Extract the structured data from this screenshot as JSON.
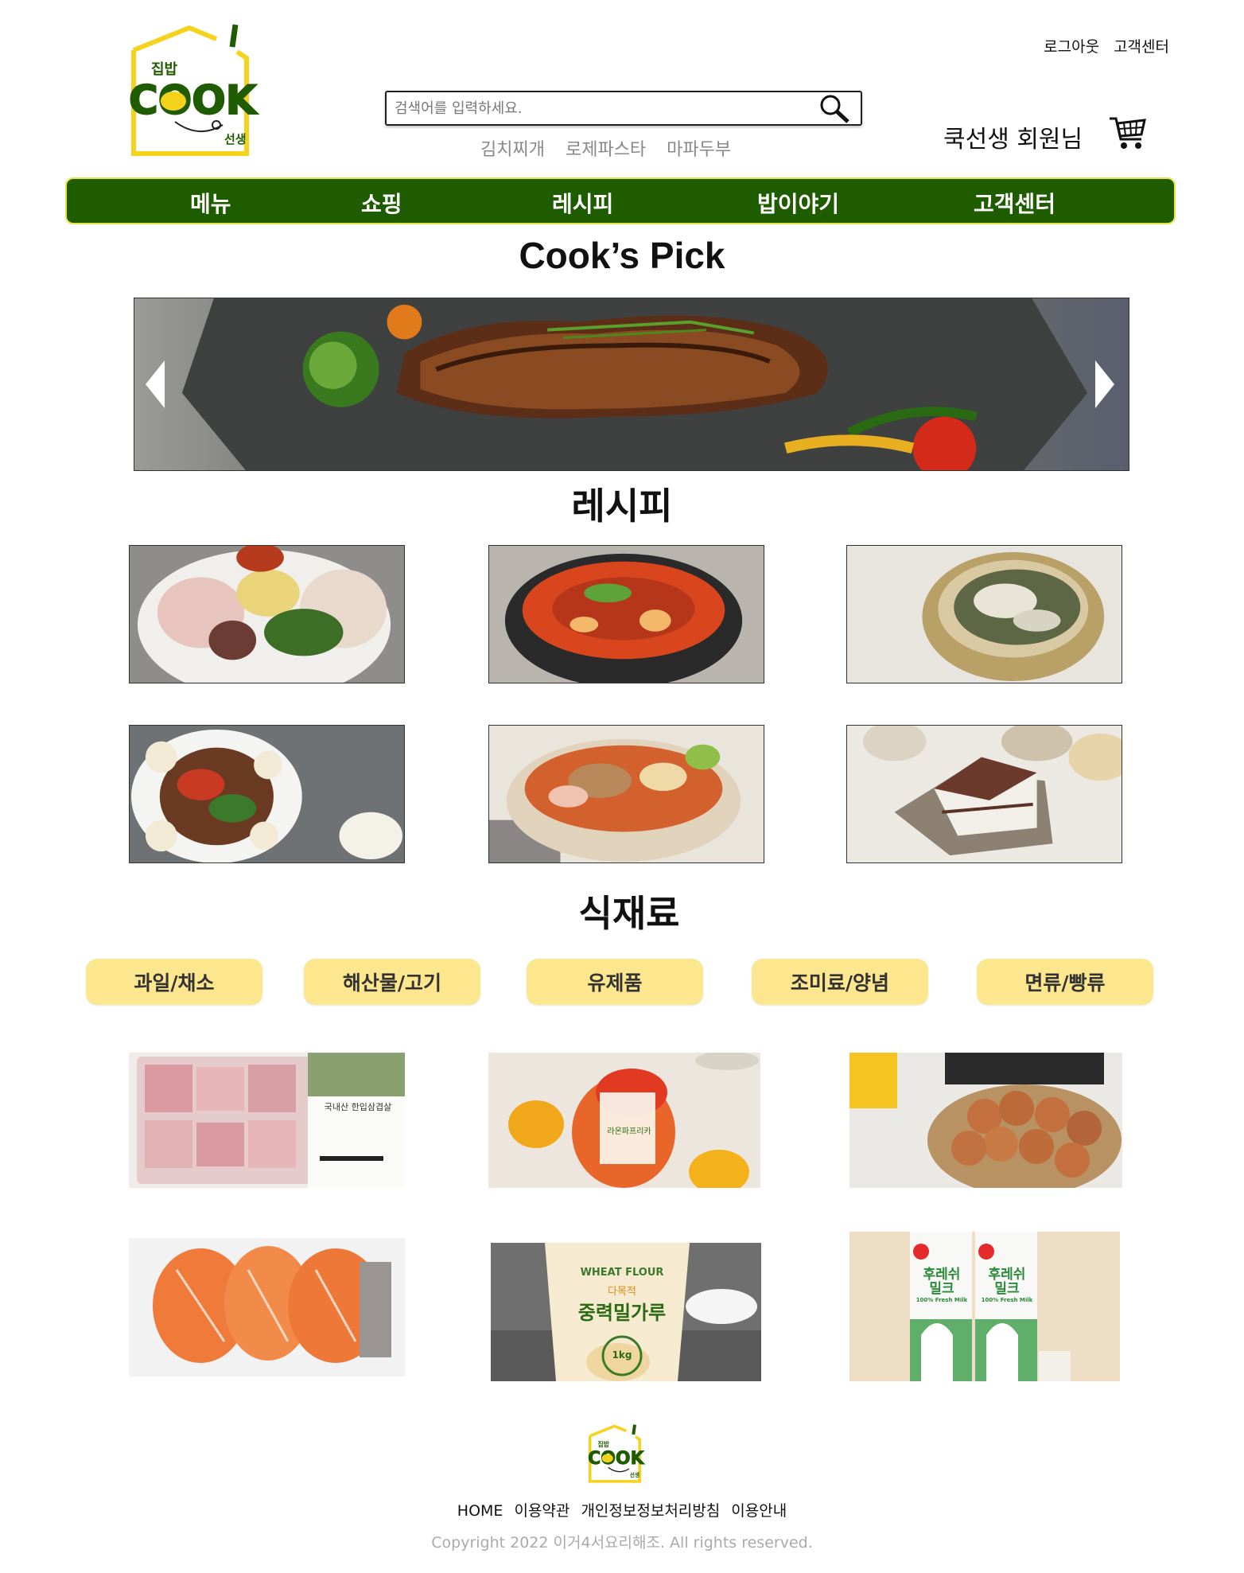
{
  "header": {
    "logo": {
      "top_text": "집밥",
      "main_text": "COOK",
      "bottom_text": "선생"
    },
    "top_links": [
      "로그아웃",
      "고객센터"
    ],
    "search": {
      "placeholder": "검색어를 입력하세요."
    },
    "keywords": [
      "김치찌개",
      "로제파스타",
      "마파두부"
    ],
    "user_name": "쿡선생 회원님"
  },
  "nav": {
    "items": [
      "메뉴",
      "쇼핑",
      "레시피",
      "밥이야기",
      "고객센터"
    ]
  },
  "pick": {
    "title": "Cook’s Pick"
  },
  "recipes": {
    "title": "레시피"
  },
  "ingredients": {
    "title": "식재료",
    "categories": [
      "과일/채소",
      "해산물/고기",
      "유제품",
      "조미료/양념",
      "면류/빵류"
    ],
    "products": {
      "pork_label": "국내산 한입삼겹살",
      "paprika_label": "라온파프리카",
      "flour_top": "WHEAT FLOUR",
      "flour_brand": "다목적",
      "flour_name": "중력밀가루",
      "flour_weight": "1kg",
      "milk_name_1": "후레쉬",
      "milk_name_2": "밀크",
      "milk_sub": "100% Fresh Milk"
    }
  },
  "footer": {
    "links": [
      "HOME",
      "이용약관",
      "개인정보정보처리방침",
      "이용안내"
    ],
    "copyright": "Copyright 2022 이거4서요리해조. All rights reserved."
  },
  "colors": {
    "nav_green": "#1f5c00",
    "nav_border": "#e8e24a",
    "category_yellow": "#fde78e",
    "logo_yellow": "#f5d31c"
  }
}
